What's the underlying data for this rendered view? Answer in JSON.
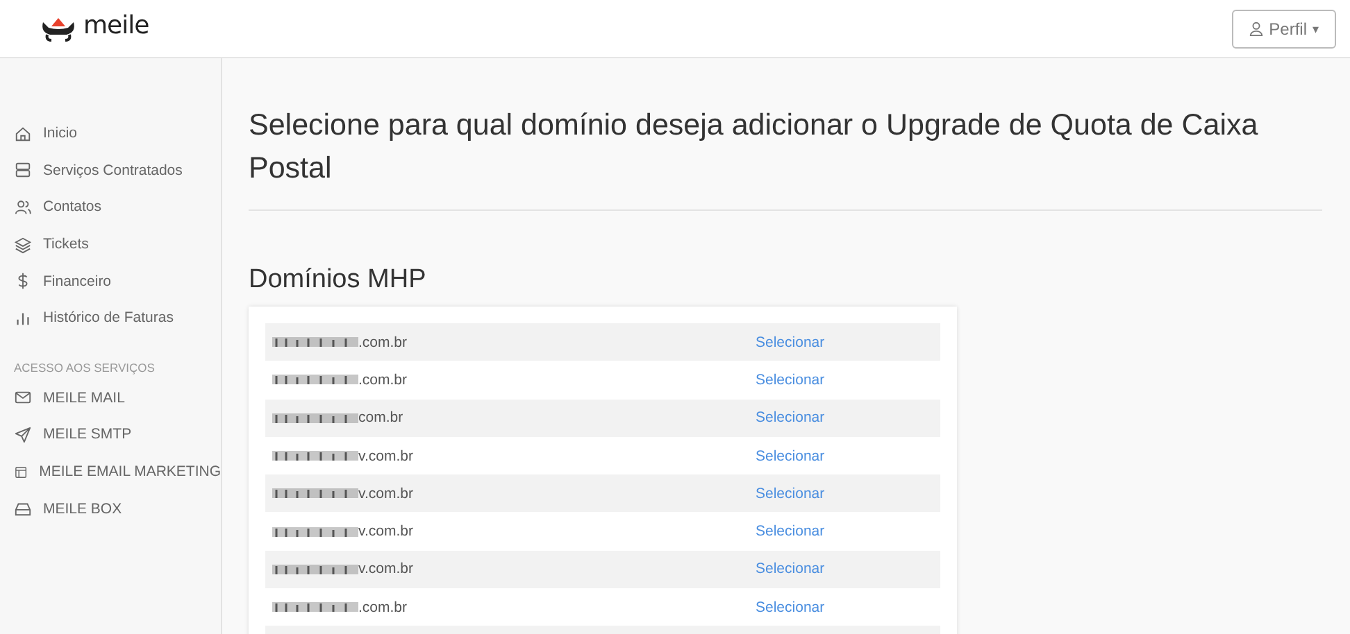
{
  "header": {
    "logo": "meile",
    "profile_button": {
      "label": "Perfil",
      "caret": "▾"
    }
  },
  "sidebar": {
    "items": [
      {
        "label": "Inicio",
        "kind": "home"
      },
      {
        "label": "Serviços Contratados",
        "kind": "server"
      },
      {
        "label": "Contatos",
        "kind": "users"
      },
      {
        "label": "Tickets",
        "kind": "layers"
      },
      {
        "label": "Financeiro",
        "kind": "dollar"
      },
      {
        "label": "Histórico de Faturas",
        "kind": "chart"
      }
    ],
    "section_title": "ACESSO AOS SERVIÇOS",
    "services": [
      {
        "label": "MEILE MAIL",
        "kind": "mail"
      },
      {
        "label": "MEILE SMTP",
        "kind": "send"
      },
      {
        "label": "MEILE EMAIL MARKETING",
        "kind": "layout"
      },
      {
        "label": "MEILE BOX",
        "kind": "box"
      }
    ]
  },
  "main": {
    "title": "Selecione para qual domínio deseja adicionar o Upgrade de Quota de Caixa Postal",
    "section": "Domínios MHP",
    "domains": [
      {
        "suffix": ".com.br",
        "action": "Selecionar"
      },
      {
        "suffix": ".com.br",
        "action": "Selecionar"
      },
      {
        "suffix": "com.br",
        "action": "Selecionar"
      },
      {
        "suffix": "v.com.br",
        "action": "Selecionar"
      },
      {
        "suffix": "v.com.br",
        "action": "Selecionar"
      },
      {
        "suffix": "v.com.br",
        "action": "Selecionar"
      },
      {
        "suffix": "v.com.br",
        "action": "Selecionar"
      },
      {
        "suffix": ".com.br",
        "action": "Selecionar"
      }
    ]
  }
}
